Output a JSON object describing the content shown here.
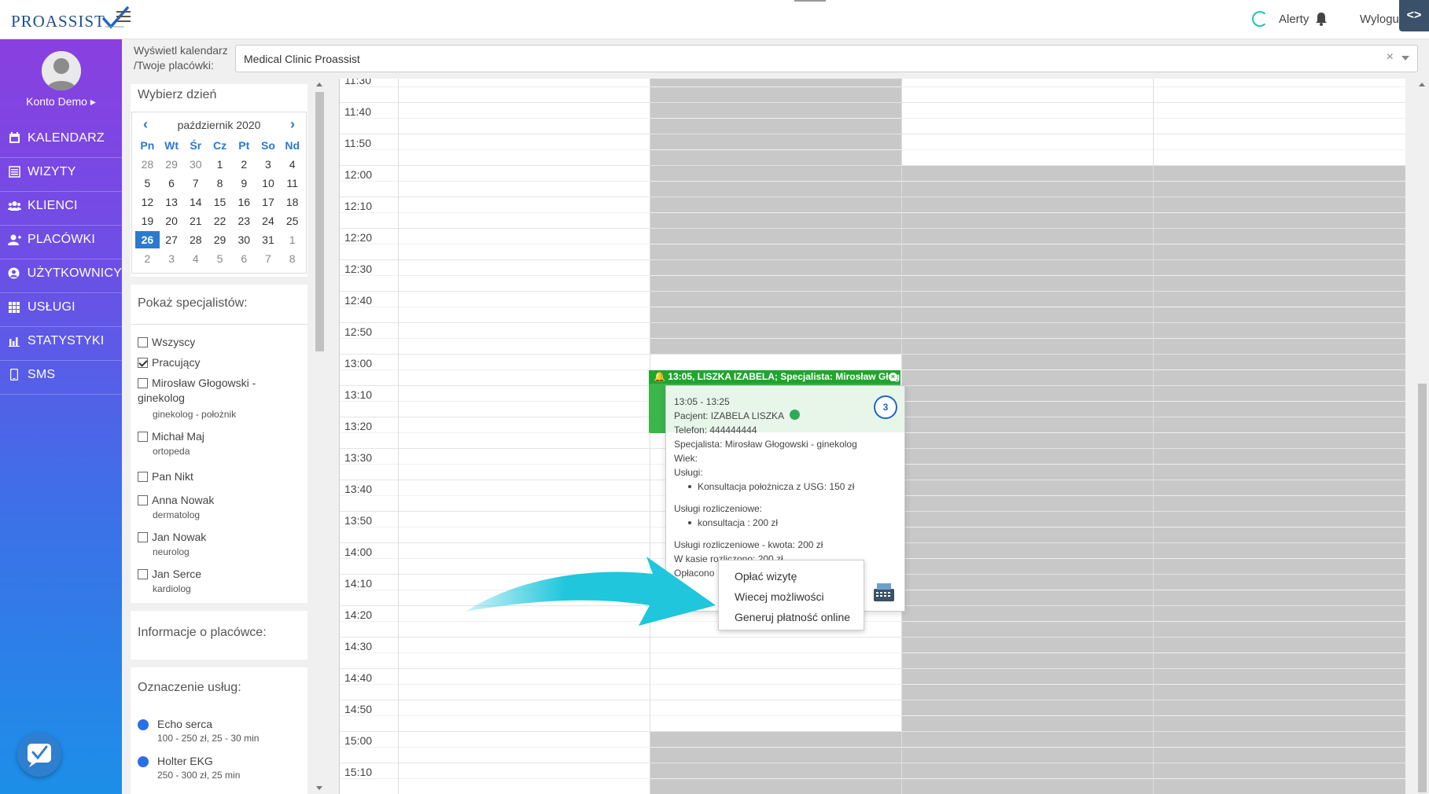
{
  "app": {
    "logo_text": "PROASSIST",
    "alerts_label": "Alerty",
    "logout_label": "Wylogu"
  },
  "sidebar": {
    "account_name": "Konto Demo ▸",
    "items": [
      {
        "label": "KALENDARZ",
        "icon": "calendar-icon"
      },
      {
        "label": "WIZYTY",
        "icon": "list-icon"
      },
      {
        "label": "KLIENCI",
        "icon": "users-icon"
      },
      {
        "label": "PLACÓWKI",
        "icon": "user-plus-icon"
      },
      {
        "label": "UŻYTKOWNICY",
        "icon": "user-circle-icon"
      },
      {
        "label": "USŁUGI",
        "icon": "grid-icon"
      },
      {
        "label": "STATYSTYKI",
        "icon": "bar-chart-icon"
      },
      {
        "label": "SMS",
        "icon": "phone-icon"
      }
    ]
  },
  "facility": {
    "label": "Wyświetl kalendarz /Twoje placówki:",
    "selected": "Medical Clinic Proassist",
    "clear": "×"
  },
  "day_picker": {
    "title": "Wybierz dzień",
    "month": "październik 2020",
    "prev": "‹",
    "next": "›",
    "weekdays": [
      "Pn",
      "Wt",
      "Śr",
      "Cz",
      "Pt",
      "So",
      "Nd"
    ],
    "weeks": [
      [
        "28",
        "29",
        "30",
        "1",
        "2",
        "3",
        "4"
      ],
      [
        "5",
        "6",
        "7",
        "8",
        "9",
        "10",
        "11"
      ],
      [
        "12",
        "13",
        "14",
        "15",
        "16",
        "17",
        "18"
      ],
      [
        "19",
        "20",
        "21",
        "22",
        "23",
        "24",
        "25"
      ],
      [
        "26",
        "27",
        "28",
        "29",
        "30",
        "31",
        "1"
      ],
      [
        "2",
        "3",
        "4",
        "5",
        "6",
        "7",
        "8"
      ]
    ],
    "today": "26"
  },
  "specialists": {
    "title": "Pokaż specjalistów:",
    "items": [
      {
        "name": "Wszyscy",
        "sub": "",
        "checked": false
      },
      {
        "name": "Pracujący",
        "sub": "",
        "checked": true
      },
      {
        "name": "Mirosław Głogowski - ginekolog",
        "sub": "ginekolog - położnik",
        "checked": false
      },
      {
        "name": "Michał Maj",
        "sub": "ortopeda",
        "checked": false
      },
      {
        "name": "Pan Nikt",
        "sub": "",
        "checked": false
      },
      {
        "name": "Anna Nowak",
        "sub": "dermatolog",
        "checked": false
      },
      {
        "name": "Jan Nowak",
        "sub": "neurolog",
        "checked": false
      },
      {
        "name": "Jan Serce",
        "sub": "kardiolog",
        "checked": false
      }
    ]
  },
  "facility_info": {
    "title": "Informacje o placówce:"
  },
  "services": {
    "title": "Oznaczenie usług:",
    "items": [
      {
        "name": "Echo serca",
        "desc": "100 - 250 zł, 25 - 30 min",
        "color": "#2a6ee8"
      },
      {
        "name": "Holter EKG",
        "desc": "250 - 300 zł, 25 min",
        "color": "#2a6ee8"
      }
    ]
  },
  "schedule": {
    "times": [
      "11:30",
      "11:40",
      "11:50",
      "12:00",
      "12:10",
      "12:20",
      "12:30",
      "12:40",
      "12:50",
      "13:00",
      "13:10",
      "13:20",
      "13:30",
      "13:40",
      "13:50",
      "14:00",
      "14:10",
      "14:20",
      "14:30",
      "14:40",
      "14:50",
      "15:00",
      "15:10"
    ]
  },
  "appointment": {
    "header": "13:05, LISZKA IZABELA; Specjalista: Mirosław Głog...",
    "close": "×",
    "time": "13:05 - 13:25",
    "patient": "Pacjent: IZABELA LISZKA",
    "phone": "Telefon: 444444444",
    "specialist": "Specjalista: Mirosław Głogowski - ginekolog",
    "age": "Wiek:",
    "services_label": "Usługi:",
    "service": "Konsultacja położnicza z USG: 150 zł",
    "billing_label": "Usługi rozliczeniowe:",
    "billing_service": "konsultacja : 200 zł",
    "billing_amount": "Usługi rozliczeniowe - kwota: 200 zł",
    "cash_settled": "W kasie rozliczono: 200 zł",
    "paid": "Opłacono",
    "count": "3"
  },
  "context_menu": {
    "items": [
      "Opłać wizytę",
      "Wiecej możliwości",
      "Generuj płatność online"
    ]
  },
  "colors": {
    "accent": "#2a7ad1",
    "appointment": "#3cb54a",
    "arrow": "#1fc6dc"
  }
}
